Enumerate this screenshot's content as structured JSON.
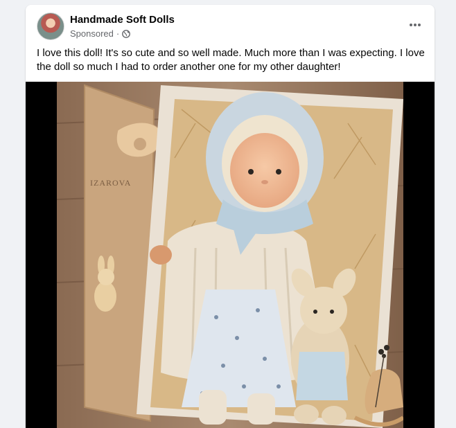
{
  "post": {
    "page_name": "Handmade Soft Dolls",
    "sponsored_label": "Sponsored",
    "separator": "·",
    "text": "I love this doll! It's so cute and so well made. Much more than I was expecting. I love the doll so much I had to order another one for my other daughter!",
    "box_lettering": "IZAROVA"
  },
  "icons": {
    "audience": "globe-icon",
    "more": "more-options-icon",
    "avatar": "page-avatar"
  },
  "colors": {
    "card_bg": "#ffffff",
    "page_bg": "#f0f2f5",
    "secondary_text": "#65676b",
    "media_bg": "#000000"
  }
}
